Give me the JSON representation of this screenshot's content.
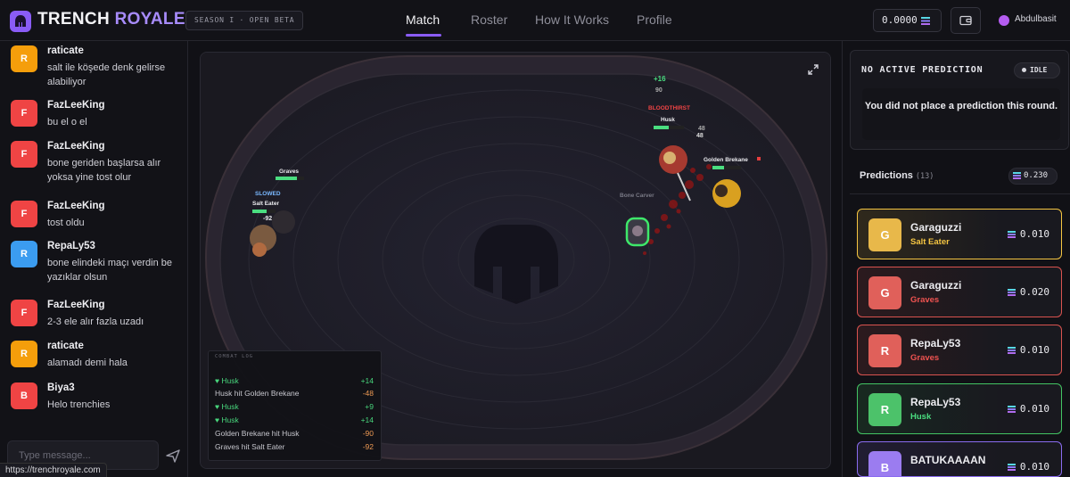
{
  "header": {
    "brand_first": "TRENCH",
    "brand_second": "ROYALE",
    "season": "SEASON I · OPEN BETA",
    "nav": [
      "Match",
      "Roster",
      "How It Works",
      "Profile"
    ],
    "active_nav": "Match",
    "balance": "0.0000",
    "username": "Abdulbasit"
  },
  "chat": {
    "messages": [
      {
        "initial": "R",
        "color": "#f59e0b",
        "name": "raticate",
        "text": "salt ile köşede denk gelirse alabiliyor"
      },
      {
        "initial": "F",
        "color": "#ef4444",
        "name": "FazLeeKing",
        "text": "bu el o el"
      },
      {
        "initial": "F",
        "color": "#ef4444",
        "name": "FazLeeKing",
        "text": "bone geriden başlarsa alır yoksa yine tost olur"
      },
      {
        "initial": "F",
        "color": "#ef4444",
        "name": "FazLeeKing",
        "text": "tost oldu"
      },
      {
        "initial": "R",
        "color": "#3b9cf0",
        "name": "RepaLy53",
        "text": "bone elindeki maçı verdin be yazıklar olsun"
      },
      {
        "initial": "F",
        "color": "#ef4444",
        "name": "FazLeeKing",
        "text": "2-3 ele alır fazla uzadı"
      },
      {
        "initial": "R",
        "color": "#f59e0b",
        "name": "raticate",
        "text": "alamadı demi hala"
      },
      {
        "initial": "B",
        "color": "#ef4444",
        "name": "Biya3",
        "text": "Helo trenchies"
      }
    ],
    "input_placeholder": "Type message...",
    "status_url": "https://trenchroyale.com"
  },
  "arena": {
    "fighters": [
      "Graves",
      "SLOWED",
      "Salt Eater",
      "Husk",
      "Golden Brekane",
      "Bone Carver"
    ],
    "status_tag": "BLOODTHIRST",
    "floating_numbers": [
      "+16",
      "90",
      "48",
      "48",
      "-92"
    ],
    "hp_fractions": {
      "Graves": 0.75,
      "Husk": 0.5,
      "Golden Brekane": 0.4,
      "Salt Eater": 0.6
    }
  },
  "combat_log": {
    "title": "COMBAT LOG",
    "entries": [
      {
        "text": "Husk",
        "heal": true,
        "value": "+14",
        "kind": "heal"
      },
      {
        "text": "Husk hit Golden Brekane",
        "heal": false,
        "value": "-48",
        "kind": "dmg"
      },
      {
        "text": "Husk",
        "heal": true,
        "value": "+9",
        "kind": "heal"
      },
      {
        "text": "Husk",
        "heal": true,
        "value": "+14",
        "kind": "heal"
      },
      {
        "text": "Golden Brekane hit Husk",
        "heal": false,
        "value": "-90",
        "kind": "dmg"
      },
      {
        "text": "Graves hit Salt Eater",
        "heal": false,
        "value": "-92",
        "kind": "dmg"
      }
    ]
  },
  "prediction": {
    "status_title": "NO ACTIVE PREDICTION",
    "status_badge": "IDLE",
    "status_message": "You did not place a prediction this round.",
    "list_title": "Predictions",
    "count": "(13)",
    "total": "0.230",
    "entries": [
      {
        "initial": "G",
        "avatar_color": "#e8b84a",
        "accent": "#f5c542",
        "user": "Garaguzzi",
        "pick": "Salt Eater",
        "pick_color": "#f5c542",
        "amount": "0.010"
      },
      {
        "initial": "G",
        "avatar_color": "#e0605a",
        "accent": "#d9534f",
        "user": "Garaguzzi",
        "pick": "Graves",
        "pick_color": "#ef5350",
        "amount": "0.020"
      },
      {
        "initial": "R",
        "avatar_color": "#e0605a",
        "accent": "#d9534f",
        "user": "RepaLy53",
        "pick": "Graves",
        "pick_color": "#ef5350",
        "amount": "0.010"
      },
      {
        "initial": "R",
        "avatar_color": "#4cc26a",
        "accent": "#43c463",
        "user": "RepaLy53",
        "pick": "Husk",
        "pick_color": "#4ade80",
        "amount": "0.010"
      },
      {
        "initial": "B",
        "avatar_color": "#9b7cf0",
        "accent": "#8a6cf0",
        "user": "BATUKAAAAN",
        "pick": "",
        "pick_color": "#a78bfa",
        "amount": "0.010"
      }
    ]
  }
}
